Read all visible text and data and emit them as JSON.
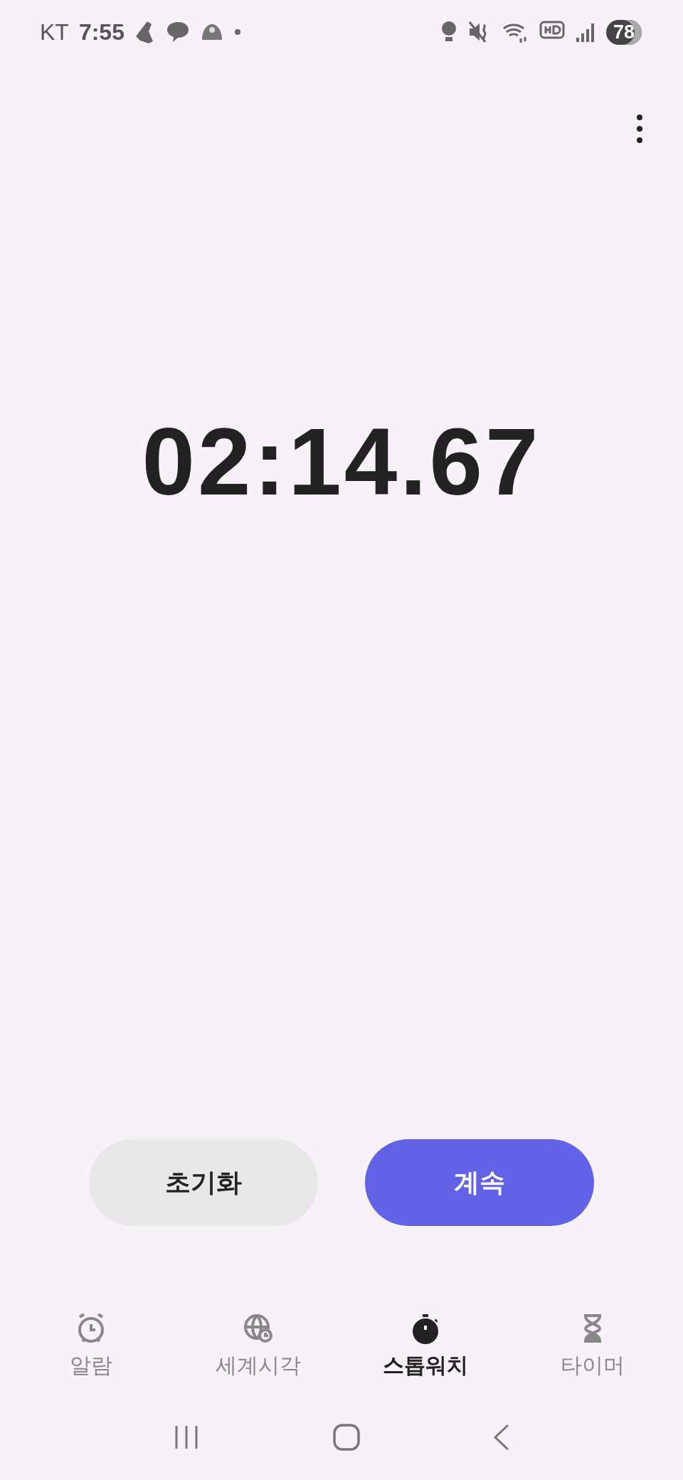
{
  "status_bar": {
    "carrier": "KT",
    "time": "7:55",
    "battery": "78"
  },
  "stopwatch": {
    "elapsed": "02:14.67"
  },
  "buttons": [
    {
      "label": "초기화",
      "kind": "secondary"
    },
    {
      "label": "계속",
      "kind": "primary"
    }
  ],
  "tabs": [
    {
      "label": "알람",
      "kind": "alarm",
      "selected": false
    },
    {
      "label": "세계시각",
      "kind": "globe",
      "selected": false
    },
    {
      "label": "스톱워치",
      "kind": "stopwatch",
      "selected": true
    },
    {
      "label": "타이머",
      "kind": "hourglass",
      "selected": false
    }
  ]
}
